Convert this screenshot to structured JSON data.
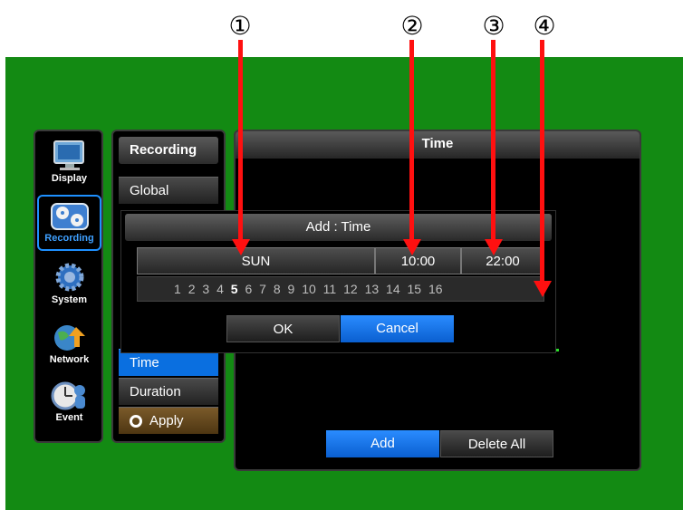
{
  "callouts": [
    "①",
    "②",
    "③",
    "④"
  ],
  "sidebar": {
    "items": [
      {
        "label": "Display",
        "icon": "monitor-icon"
      },
      {
        "label": "Recording",
        "icon": "recording-reels-icon"
      },
      {
        "label": "System",
        "icon": "system-gear-icon"
      },
      {
        "label": "Network",
        "icon": "network-globe-icon"
      },
      {
        "label": "Event",
        "icon": "event-clock-icon"
      }
    ],
    "active": "Recording"
  },
  "menu": {
    "title": "Recording",
    "items": [
      "Global",
      "Time",
      "Duration",
      "Apply"
    ],
    "active": "Time"
  },
  "main": {
    "title": "Time",
    "add_label": "Add",
    "delete_all_label": "Delete All"
  },
  "dialog": {
    "title": "Add : Time",
    "day": "SUN",
    "start_time": "10:00",
    "end_time": "22:00",
    "weeks": [
      "1",
      "2",
      "3",
      "4",
      "5",
      "6",
      "7",
      "8",
      "9",
      "10",
      "11",
      "12",
      "13",
      "14",
      "15",
      "16"
    ],
    "ok_label": "OK",
    "cancel_label": "Cancel"
  },
  "colors": {
    "background": "#138a13",
    "accent": "#0a6fe0",
    "arrow": "#ff1010"
  }
}
